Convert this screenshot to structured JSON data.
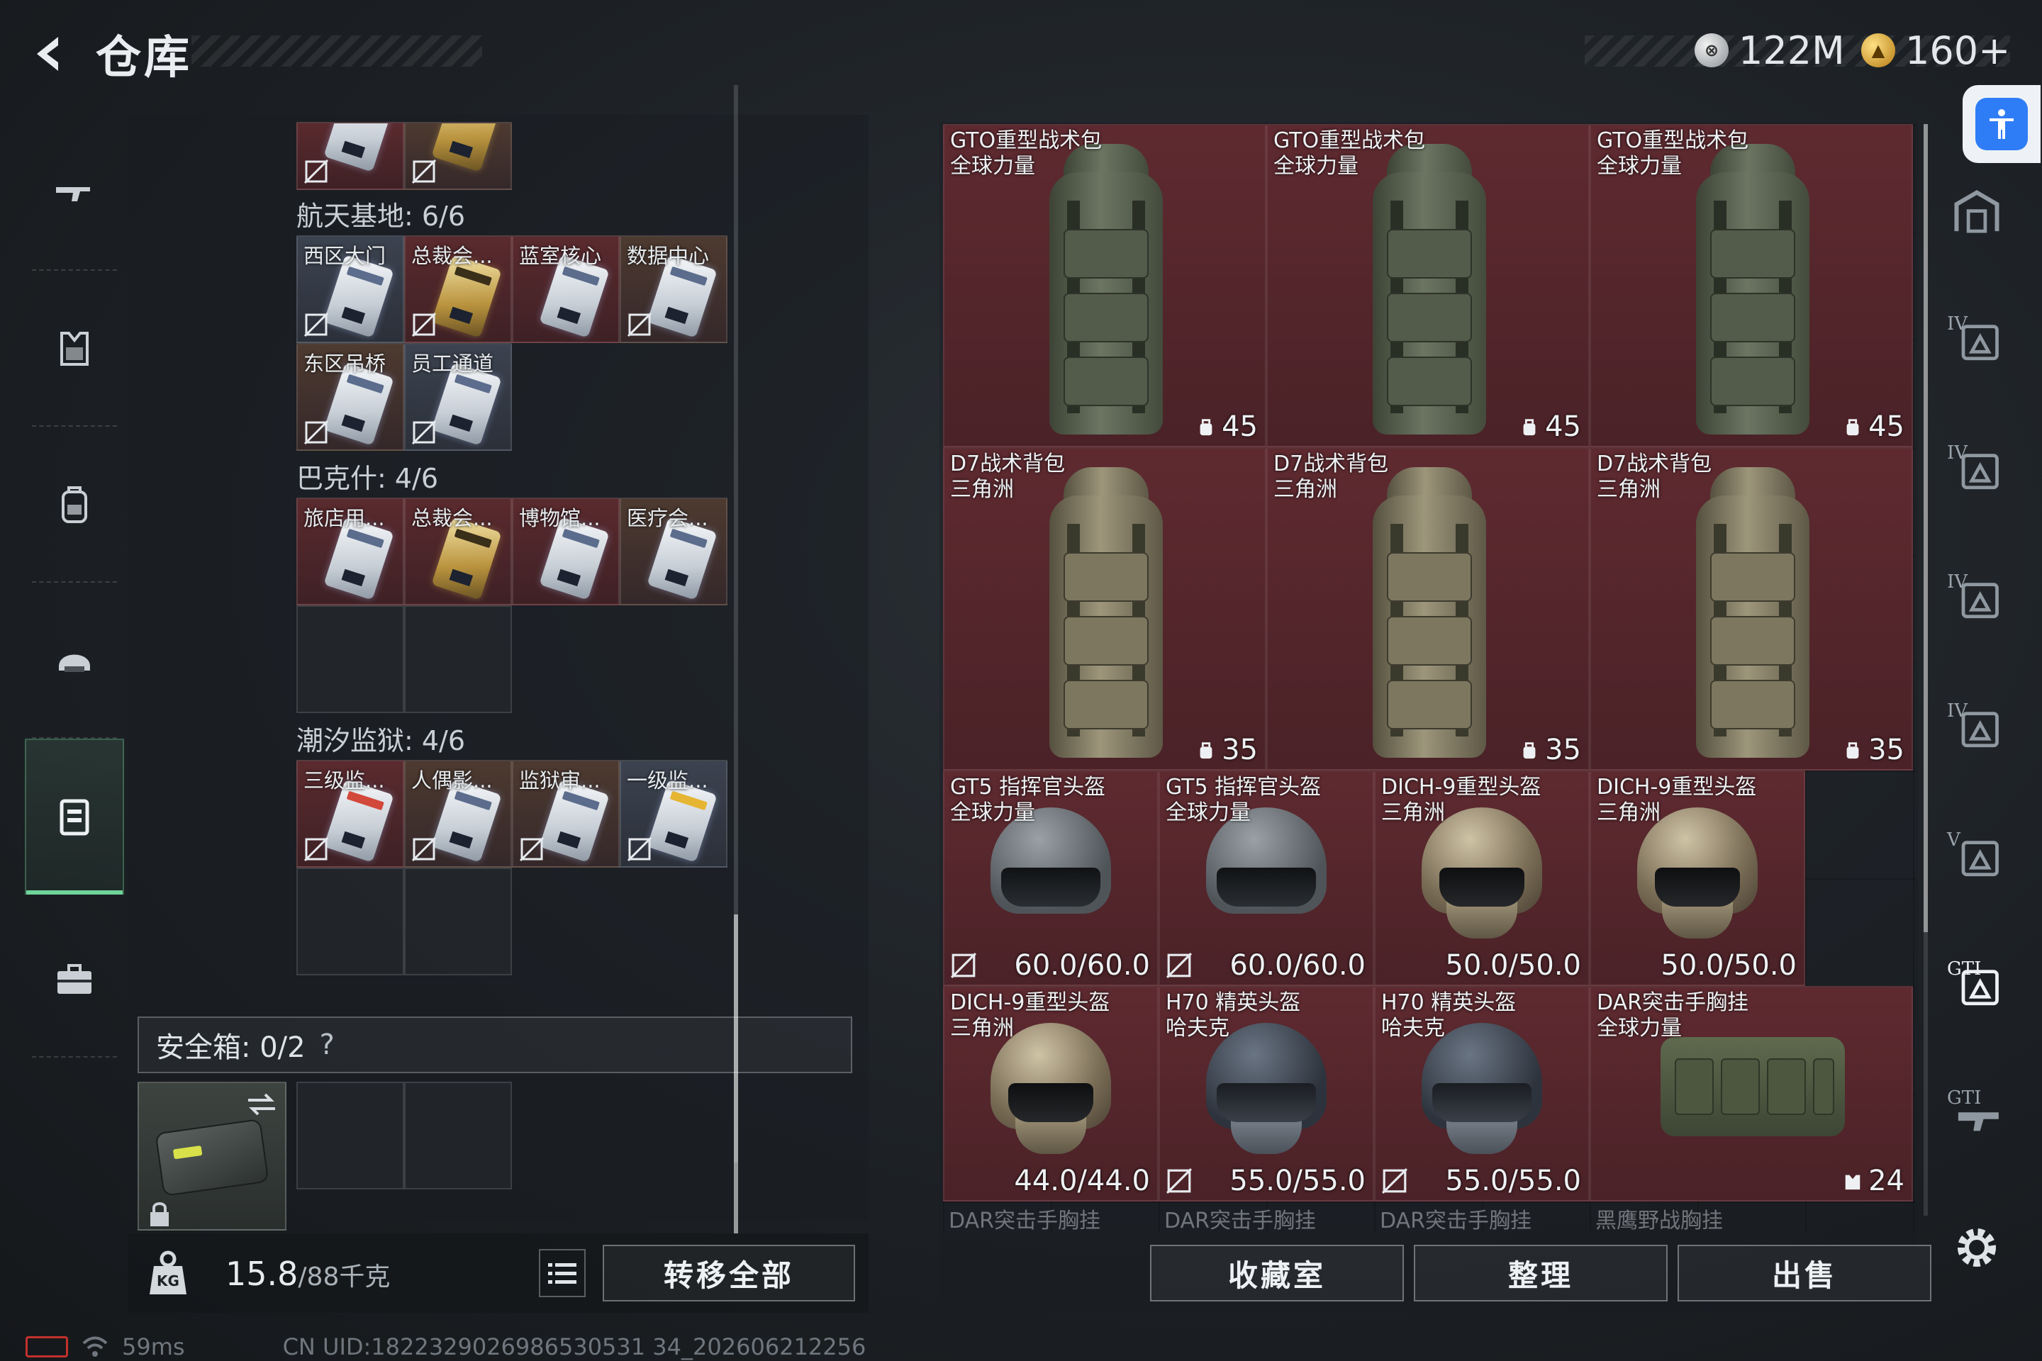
{
  "header": {
    "title": "仓库",
    "currency_silver": "122M",
    "currency_gold": "160+"
  },
  "left_nav": {
    "items": [
      {
        "icon": "rifle-icon",
        "active": false
      },
      {
        "icon": "body-armor-icon",
        "active": false
      },
      {
        "icon": "backpack-icon",
        "active": false
      },
      {
        "icon": "helmet-icon",
        "active": false
      },
      {
        "icon": "keycard-case-icon",
        "active": true
      },
      {
        "icon": "briefcase-icon",
        "active": false
      }
    ]
  },
  "key_sections": [
    {
      "title": "航天基地: 6/6",
      "cards": [
        {
          "label": "西区大门",
          "tone": "blue",
          "gold": false,
          "bound": true
        },
        {
          "label": "总裁会...",
          "tone": "red",
          "gold": true,
          "bound": true
        },
        {
          "label": "蓝室核心",
          "tone": "red",
          "gold": false,
          "bound": false
        },
        {
          "label": "数据中心",
          "tone": "brown",
          "gold": false,
          "bound": true
        },
        {
          "label": "东区吊桥",
          "tone": "brown",
          "gold": false,
          "bound": true
        },
        {
          "label": "员工通道",
          "tone": "blue",
          "gold": false,
          "bound": true
        }
      ]
    },
    {
      "title": "巴克什: 4/6",
      "cards": [
        {
          "label": "旅店用...",
          "tone": "red",
          "gold": false,
          "bound": false
        },
        {
          "label": "总裁会...",
          "tone": "red",
          "gold": true,
          "bound": false
        },
        {
          "label": "博物馆...",
          "tone": "red",
          "gold": false,
          "bound": false
        },
        {
          "label": "医疗会...",
          "tone": "brown",
          "gold": false,
          "bound": false
        }
      ]
    },
    {
      "title": "潮汐监狱: 4/6",
      "cards": [
        {
          "label": "三级监...",
          "tone": "red",
          "gold": false,
          "tag": "redtag",
          "bound": true
        },
        {
          "label": "人偶影...",
          "tone": "brown",
          "gold": false,
          "bound": true
        },
        {
          "label": "监狱审...",
          "tone": "brown",
          "gold": false,
          "bound": true
        },
        {
          "label": "一级监...",
          "tone": "blue",
          "gold": false,
          "tag": "yellowtag",
          "bound": true
        }
      ]
    }
  ],
  "safebox": {
    "label": "安全箱:  0/2",
    "help": "?"
  },
  "weight": {
    "current": "15.8",
    "max": "/88千克"
  },
  "buttons": {
    "transfer_all": "转移全部",
    "collection": "收藏室",
    "sort": "整理",
    "sell": "出售"
  },
  "status": {
    "ping": "59ms",
    "uid": "CN UID:1822329026986530531 34_202606212256"
  },
  "items": [
    {
      "kind": "backpack",
      "style": "green",
      "name1": "GTO重型战术包",
      "name2": "全球力量",
      "stat": "45"
    },
    {
      "kind": "backpack",
      "style": "green",
      "name1": "GTO重型战术包",
      "name2": "全球力量",
      "stat": "45"
    },
    {
      "kind": "backpack",
      "style": "green",
      "name1": "GTO重型战术包",
      "name2": "全球力量",
      "stat": "45"
    },
    {
      "kind": "backpack",
      "style": "tan",
      "name1": "D7战术背包",
      "name2": "三角洲",
      "stat": "35"
    },
    {
      "kind": "backpack",
      "style": "tan",
      "name1": "D7战术背包",
      "name2": "三角洲",
      "stat": "35"
    },
    {
      "kind": "backpack",
      "style": "tan",
      "name1": "D7战术背包",
      "name2": "三角洲",
      "stat": "35"
    },
    {
      "kind": "helmet",
      "style": "grey",
      "name1": "GT5 指挥官头盔",
      "name2": "全球力量",
      "stat": "60.0/60.0",
      "bound": true
    },
    {
      "kind": "helmet",
      "style": "grey",
      "name1": "GT5 指挥官头盔",
      "name2": "全球力量",
      "stat": "60.0/60.0",
      "bound": true
    },
    {
      "kind": "helmet",
      "style": "camo",
      "name1": "DICH-9重型头盔",
      "name2": "三角洲",
      "stat": "50.0/50.0",
      "bound": false
    },
    {
      "kind": "helmet",
      "style": "camo",
      "name1": "DICH-9重型头盔",
      "name2": "三角洲",
      "stat": "50.0/50.0",
      "bound": false
    },
    {
      "kind": "helmet",
      "style": "camo",
      "name1": "DICH-9重型头盔",
      "name2": "三角洲",
      "stat": "44.0/44.0",
      "bound": false
    },
    {
      "kind": "helmet",
      "style": "dark",
      "name1": "H70 精英头盔",
      "name2": "哈夫克",
      "stat": "55.0/55.0",
      "bound": true
    },
    {
      "kind": "helmet",
      "style": "dark",
      "name1": "H70 精英头盔",
      "name2": "哈夫克",
      "stat": "55.0/55.0",
      "bound": true
    },
    {
      "kind": "rig",
      "style": "green",
      "name1": "DAR突击手胸挂",
      "name2": "全球力量",
      "stat": "24"
    }
  ],
  "peek_row": [
    "DAR突击手胸挂",
    "DAR突击手胸挂",
    "DAR突击手胸挂",
    "黑鹰野战胸挂"
  ],
  "right_rail": [
    {
      "tag": "",
      "icon": "safe-room-icon"
    },
    {
      "tag": "IV",
      "icon": "folder-filter-icon"
    },
    {
      "tag": "IV",
      "icon": "helmet-filter-icon"
    },
    {
      "tag": "IV",
      "icon": "armor-filter-icon"
    },
    {
      "tag": "IV",
      "icon": "armor-filter-icon"
    },
    {
      "tag": "V",
      "icon": "helmet-filter-icon"
    },
    {
      "tag": "GTI",
      "icon": "armor-filter-icon",
      "active": true
    },
    {
      "tag": "GTI",
      "icon": "gun-filter-icon"
    }
  ]
}
